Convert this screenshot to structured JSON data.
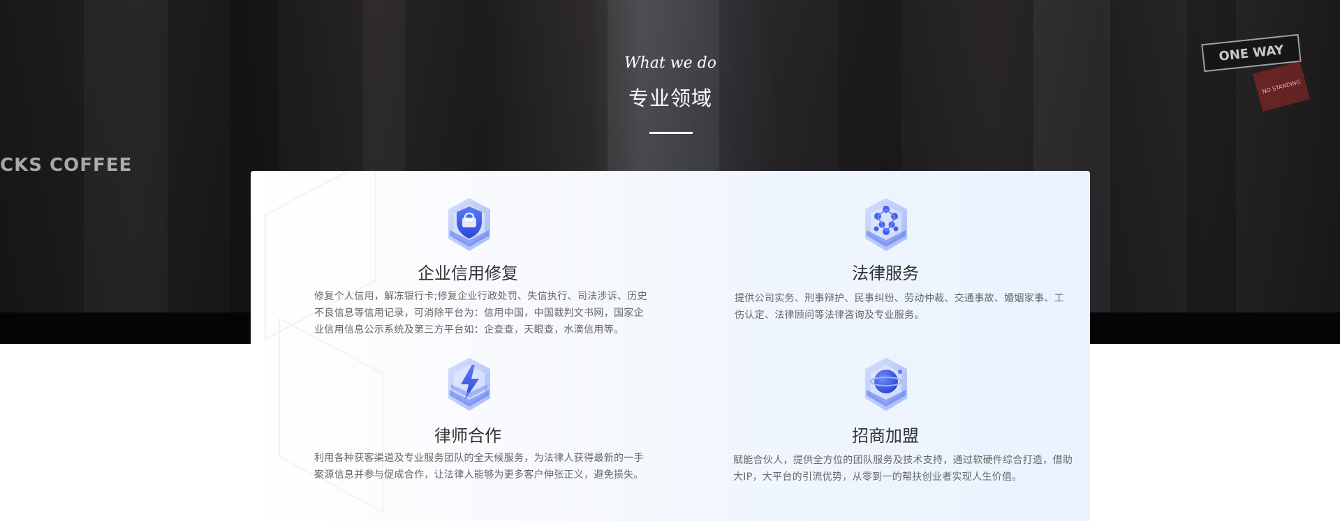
{
  "hero": {
    "subtitle": "What we do",
    "title": "专业领域",
    "sign_coffee": "CKS COFFEE",
    "sign_oneway": "ONE WAY",
    "sign_nostanding": "NO STANDING"
  },
  "colors": {
    "accent": "#3b5cf0",
    "title_text": "#333333",
    "body_text": "#666666"
  },
  "services": [
    {
      "icon": "shield-cube-icon",
      "title": "企业信用修复",
      "description": "修复个人信用，解冻银行卡;修复企业行政处罚、失信执行、司法涉诉、历史不良信息等信用记录，可消除平台为：信用中国，中国裁判文书网，国家企业信用信息公示系统及第三方平台如：企查查，天眼查，水滴信用等。"
    },
    {
      "icon": "network-cube-icon",
      "title": "法律服务",
      "description": "提供公司实务、刑事辩护、民事纠纷、劳动仲裁、交通事故、婚姻家事、工伤认定、法律顾问等法律咨询及专业服务。"
    },
    {
      "icon": "lightning-cube-icon",
      "title": "律师合作",
      "description": "利用各种获客渠道及专业服务团队的全天候服务，为法律人获得最新的一手案源信息并参与促成合作，让法律人能够为更多客户伸张正义，避免损失。"
    },
    {
      "icon": "globe-cube-icon",
      "title": "招商加盟",
      "description": "赋能合伙人，提供全方位的团队服务及技术支持，通过软硬件综合打造，借助大IP，大平台的引流优势，从零到一的帮扶创业者实现人生价值。"
    }
  ]
}
